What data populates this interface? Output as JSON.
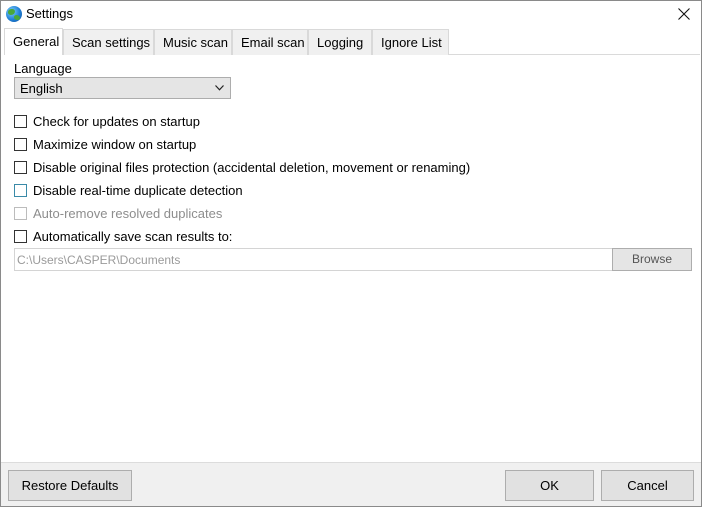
{
  "window": {
    "title": "Settings",
    "app_icon": "globe-icon",
    "close_icon": "close-icon"
  },
  "tabs": [
    {
      "label": "General",
      "active": true
    },
    {
      "label": "Scan settings",
      "active": false
    },
    {
      "label": "Music scan",
      "active": false
    },
    {
      "label": "Email scan",
      "active": false
    },
    {
      "label": "Logging",
      "active": false
    },
    {
      "label": "Ignore List",
      "active": false
    }
  ],
  "general": {
    "language_label": "Language",
    "language_value": "English",
    "options": [
      {
        "label": "Check for updates on startup",
        "checked": false,
        "enabled": true
      },
      {
        "label": "Maximize window on startup",
        "checked": false,
        "enabled": true
      },
      {
        "label": "Disable original files protection (accidental deletion, movement or renaming)",
        "checked": false,
        "enabled": true
      },
      {
        "label": "Disable real-time duplicate detection",
        "checked": false,
        "enabled": true
      },
      {
        "label": "Auto-remove resolved duplicates",
        "checked": false,
        "enabled": false
      },
      {
        "label": "Automatically save scan results to:",
        "checked": false,
        "enabled": true
      }
    ],
    "save_path": "C:\\Users\\CASPER\\Documents",
    "browse_label": "Browse"
  },
  "footer": {
    "restore_label": "Restore Defaults",
    "ok_label": "OK",
    "cancel_label": "Cancel"
  }
}
